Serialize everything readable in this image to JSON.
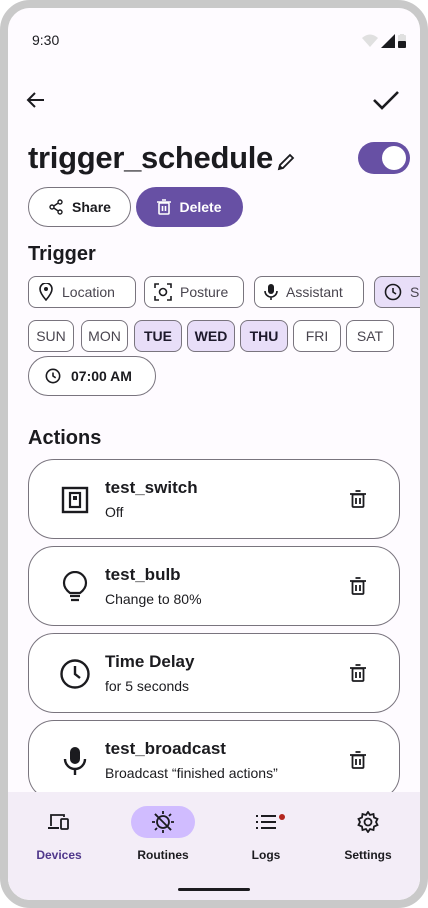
{
  "status_bar": {
    "time": "9:30"
  },
  "page": {
    "title": "trigger_schedule",
    "enabled": true
  },
  "buttons": {
    "share": "Share",
    "delete": "Delete"
  },
  "trigger": {
    "heading": "Trigger",
    "chips": [
      {
        "label": "Location",
        "icon": "location-pin-icon",
        "selected": false
      },
      {
        "label": "Posture",
        "icon": "posture-scan-icon",
        "selected": false
      },
      {
        "label": "Assistant",
        "icon": "microphone-icon",
        "selected": false
      },
      {
        "label": "Sc",
        "icon": "clock-icon",
        "selected": true
      }
    ],
    "days": [
      {
        "label": "SUN",
        "selected": false
      },
      {
        "label": "MON",
        "selected": false
      },
      {
        "label": "TUE",
        "selected": true
      },
      {
        "label": "WED",
        "selected": true
      },
      {
        "label": "THU",
        "selected": true
      },
      {
        "label": "FRI",
        "selected": false
      },
      {
        "label": "SAT",
        "selected": false
      }
    ],
    "time": "07:00 AM"
  },
  "actions": {
    "heading": "Actions",
    "items": [
      {
        "name": "test_switch",
        "detail": "Off",
        "icon": "switch-icon"
      },
      {
        "name": "test_bulb",
        "detail": "Change to 80%",
        "icon": "bulb-icon"
      },
      {
        "name": "Time Delay",
        "detail": "for 5 seconds",
        "icon": "clock-icon"
      },
      {
        "name": "test_broadcast",
        "detail": "Broadcast “finished actions”",
        "icon": "microphone-icon"
      }
    ]
  },
  "nav": {
    "items": [
      {
        "label": "Devices",
        "icon": "devices-icon",
        "active": false
      },
      {
        "label": "Routines",
        "icon": "routines-icon",
        "active": true
      },
      {
        "label": "Logs",
        "icon": "logs-icon",
        "active": false,
        "badge": true
      },
      {
        "label": "Settings",
        "icon": "gear-icon",
        "active": false
      }
    ]
  },
  "colors": {
    "primary": "#6750a4",
    "selected_chip": "#e8def8",
    "nav_indicator": "#d0bcff",
    "nav_bg": "#f3edf7",
    "badge": "#b3261e"
  }
}
